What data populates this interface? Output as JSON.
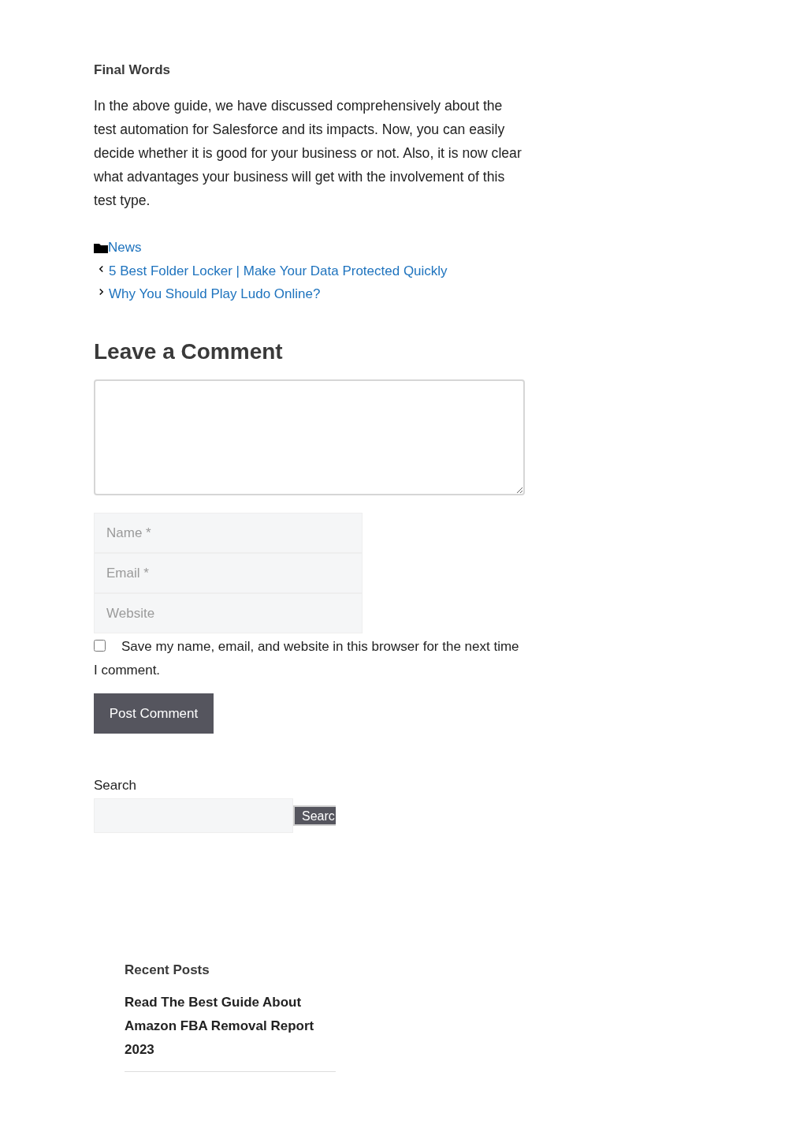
{
  "section_heading": "Final Words",
  "paragraph": "In the above guide, we have discussed comprehensively about the test automation for Salesforce and its impacts. Now, you can easily decide whether it is good for your business or not. Also, it is now clear what advantages your business will get with the involvement of this test type.",
  "category": "News",
  "post_navigation": [
    {
      "kind": "previous",
      "title": "5 Best Folder Locker | Make Your Data Protected Quickly"
    },
    {
      "kind": "next",
      "title": "Why You Should Play Ludo Online?"
    }
  ],
  "comment_form": {
    "title": "Leave a Comment",
    "fields": [
      {
        "placeholder": "Name *"
      },
      {
        "placeholder": "Email *"
      },
      {
        "placeholder": "Website"
      }
    ],
    "save_consent": {
      "label": "Save my name, email, and website in this browser for the next time I comment.",
      "checked": false
    },
    "submit": "Post Comment"
  },
  "search": {
    "label": "Search",
    "button": "Searc"
  },
  "recent_posts": {
    "title": "Recent Posts",
    "items": [
      "Read The Best Guide About Amazon FBA Removal Report 2023"
    ]
  }
}
